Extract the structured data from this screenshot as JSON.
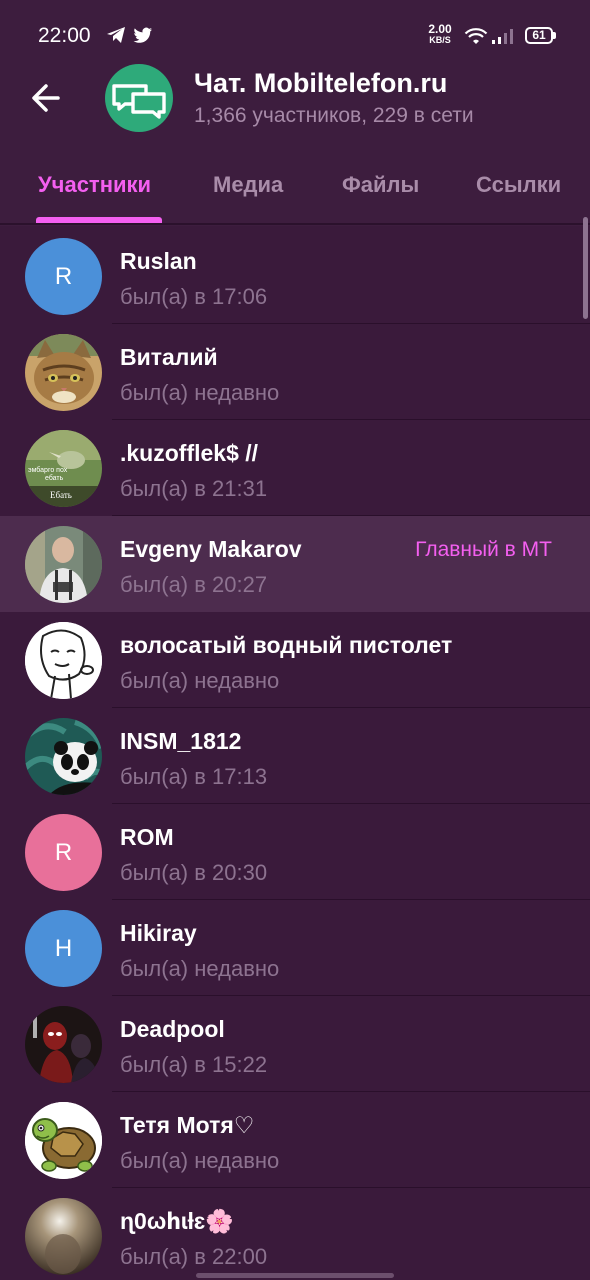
{
  "status_bar": {
    "time": "22:00",
    "speed_value": "2.00",
    "speed_unit": "KB/S",
    "battery": "61"
  },
  "header": {
    "title": "Чат. Mobiltelefon.ru",
    "subtitle": "1,366 участников, 229 в сети",
    "back_icon": "arrow-left-icon",
    "avatar_icon": "chat-bubbles-icon",
    "avatar_color": "#2eaa7a"
  },
  "tabs": [
    {
      "label": "Участники",
      "active": true
    },
    {
      "label": "Медиа",
      "active": false
    },
    {
      "label": "Файлы",
      "active": false
    },
    {
      "label": "Ссылки",
      "active": false
    }
  ],
  "members": [
    {
      "name": "Ruslan",
      "status": "был(а) в 17:06",
      "initial": "R",
      "avatar_color": "#4b90d9"
    },
    {
      "name": "Виталий",
      "status": "был(а) недавно",
      "avatar_image": "cat-photo"
    },
    {
      "name": ".kuzofflek$ //",
      "status": "был(а) в 21:31",
      "avatar_image": "bird-meme",
      "avatar_caption_1": "эмбарго пох",
      "avatar_caption_2": "ебать",
      "avatar_caption_3": "Ебать"
    },
    {
      "name": "Evgeny Makarov",
      "status": "был(а) в 20:27",
      "role": "Главный в МТ",
      "highlighted": true,
      "avatar_image": "man-photo"
    },
    {
      "name": "волосатый водный пистолет",
      "status": "был(а) недавно",
      "avatar_image": "meme-face-drawing"
    },
    {
      "name": "INSM_1812",
      "status": "был(а) в 17:13",
      "avatar_image": "panda-photo"
    },
    {
      "name": "ROM",
      "status": "был(а) в 20:30",
      "initial": "R",
      "avatar_color": "#e8709a"
    },
    {
      "name": "Hikiray",
      "status": "был(а) недавно",
      "initial": "H",
      "avatar_color": "#4b90d9"
    },
    {
      "name": "Deadpool",
      "status": "был(а) в 15:22",
      "avatar_image": "deadpool-photo"
    },
    {
      "name": "Тетя Мотя♡",
      "status": "был(а) недавно",
      "avatar_image": "turtle-cartoon"
    },
    {
      "name": "ɳ0ωհɩƚɛ🌸",
      "status": "был(а) в 22:00",
      "avatar_image": "blurry-photo"
    }
  ],
  "colors": {
    "background": "#3a1a3b",
    "accent": "#f45ff0",
    "muted_text": "#8d7390"
  }
}
